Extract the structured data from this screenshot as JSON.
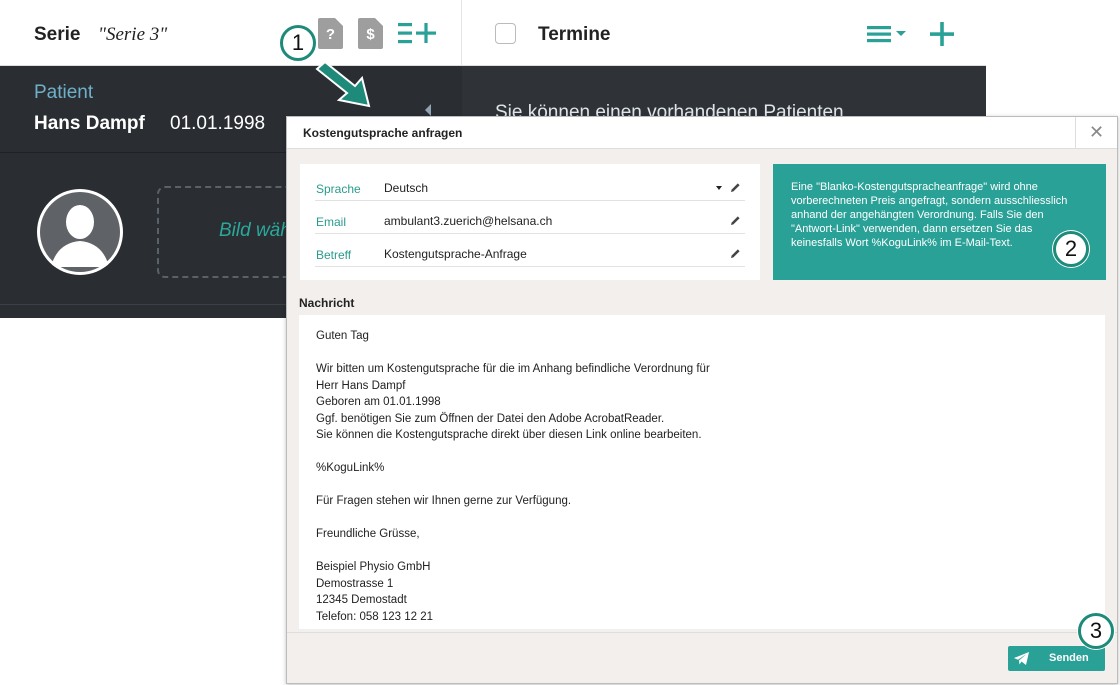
{
  "app": {
    "series_label": "Serie",
    "series_name": "\"Serie 3\"",
    "doc_question_glyph": "?",
    "doc_dollar_glyph": "$",
    "termine_title": "Termine",
    "patient_heading": "Patient",
    "patient_name": "Hans Dampf",
    "patient_dob": "01.01.1998",
    "image_pick_label": "Bild wählen",
    "right_panel_text": "Sie können einen vorhandenen Patienten",
    "icons": [
      "doc-question-icon",
      "doc-dollar-icon",
      "list-add-icon",
      "menu-dropdown-icon",
      "plus-icon",
      "avatar-icon"
    ],
    "accent_color": "#2aa197"
  },
  "annotations": {
    "badge_1": "1",
    "badge_2": "2",
    "badge_3": "3"
  },
  "dialog": {
    "title": "Kostengutsprache anfragen",
    "close_glyph": "✕",
    "fields": [
      {
        "label": "Sprache",
        "value": "Deutsch"
      },
      {
        "label": "Email",
        "value": "ambulant3.zuerich@helsana.ch"
      },
      {
        "label": "Betreff",
        "value": "Kostengutsprache-Anfrage"
      }
    ],
    "info_text": "Eine \"Blanko-Kostengutspracheanfrage\" wird ohne\nvorberechneten Preis angefragt, sondern ausschliesslich\nanhand der angehängten Verordnung. Falls Sie den\n\"Antwort-Link\" verwenden, dann ersetzen Sie das\nkeinesfalls Wort %KoguLink% im E-Mail-Text.",
    "message_label": "Nachricht",
    "message_text": "Guten Tag\n\nWir bitten um Kostengutsprache für die im Anhang befindliche Verordnung für\nHerr Hans Dampf\nGeboren am 01.01.1998\nGgf. benötigen Sie zum Öffnen der Datei den Adobe AcrobatReader.\nSie können die Kostengutsprache direkt über diesen Link online bearbeiten.\n\n%KoguLink%\n\nFür Fragen stehen wir Ihnen gerne zur Verfügung.\n\nFreundliche Grüsse,\n\nBeispiel Physio GmbH\nDemostrasse 1\n12345 Demostadt\nTelefon: 058 123 12 21",
    "send_label": "Senden"
  }
}
